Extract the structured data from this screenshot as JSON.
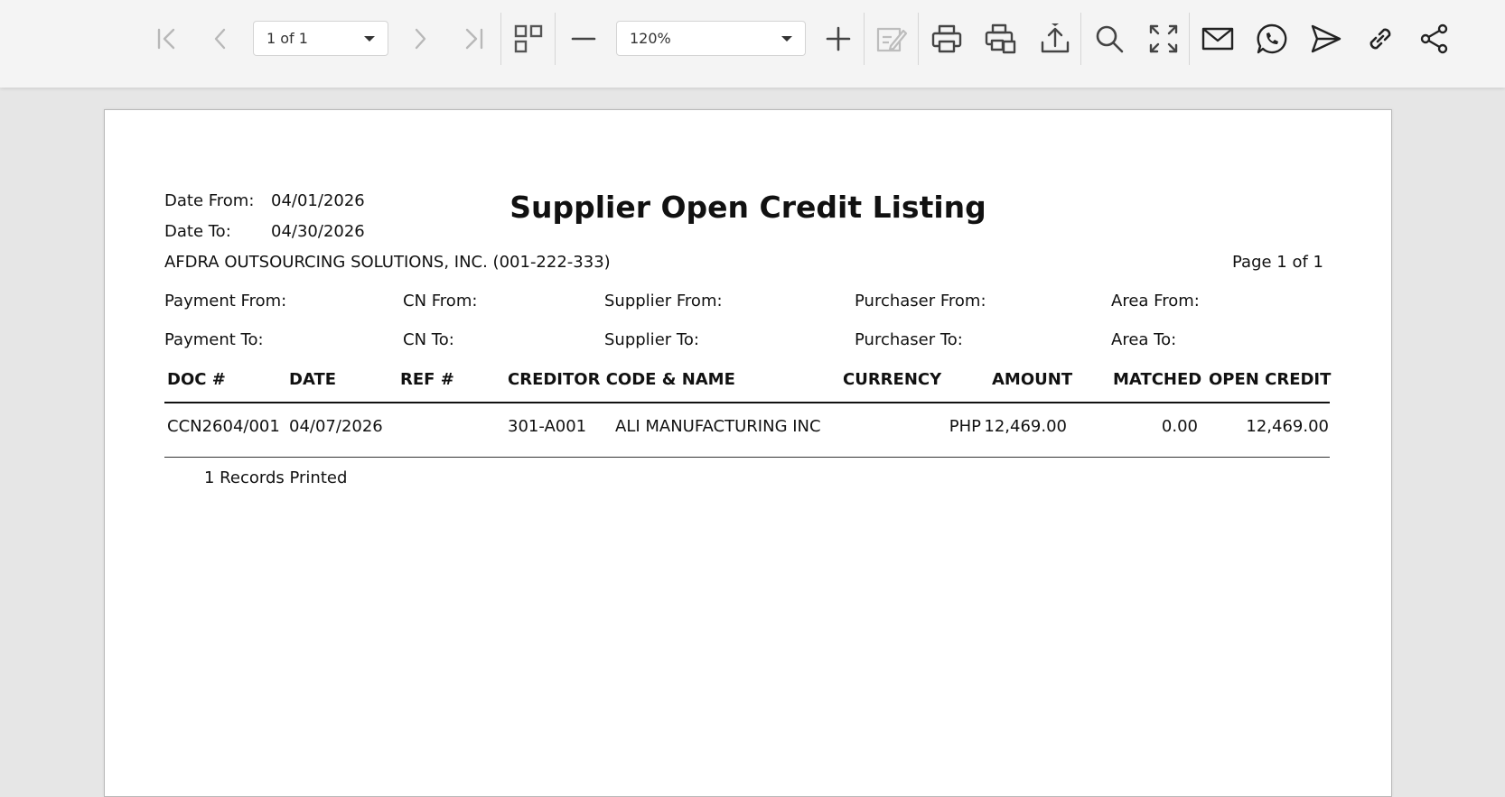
{
  "toolbar": {
    "page_selector": {
      "value": "1 of 1"
    },
    "zoom_selector": {
      "value": "120%"
    },
    "icons": [
      "first-page-icon",
      "previous-page-icon",
      "next-page-icon",
      "last-page-icon",
      "thumbnails-icon",
      "zoom-out-icon",
      "zoom-in-icon",
      "annotate-icon",
      "print-icon",
      "print-options-icon",
      "export-icon",
      "search-icon",
      "fullscreen-icon",
      "email-icon",
      "whatsapp-icon",
      "send-icon",
      "link-icon",
      "share-icon"
    ]
  },
  "report": {
    "title": "Supplier Open Credit Listing",
    "date_from_label": "Date From:",
    "date_from": "04/01/2026",
    "date_to_label": "Date To:",
    "date_to": "04/30/2026",
    "company": "AFDRA OUTSOURCING SOLUTIONS, INC. (001-222-333)",
    "page_info": "Page 1 of 1",
    "filters": {
      "payment_from": "Payment From:",
      "payment_to": "Payment To:",
      "cn_from": "CN From:",
      "cn_to": "CN To:",
      "supplier_from": "Supplier From:",
      "supplier_to": "Supplier To:",
      "purchaser_from": "Purchaser From:",
      "purchaser_to": "Purchaser To:",
      "area_from": "Area From:",
      "area_to": "Area To:"
    },
    "columns": {
      "doc": "DOC #",
      "date": "DATE",
      "ref": "REF #",
      "creditor": "CREDITOR CODE & NAME",
      "currency": "CURRENCY",
      "amount": "AMOUNT",
      "matched": "MATCHED",
      "open_credit": "OPEN CREDIT"
    },
    "rows": [
      {
        "doc": "CCN2604/001",
        "date": "04/07/2026",
        "ref": "",
        "creditor_code": "301-A001",
        "creditor_name": "ALI MANUFACTURING INC",
        "currency": "PHP",
        "amount": "12,469.00",
        "matched": "0.00",
        "open_credit": "12,469.00"
      }
    ],
    "footer": "1 Records Printed"
  }
}
